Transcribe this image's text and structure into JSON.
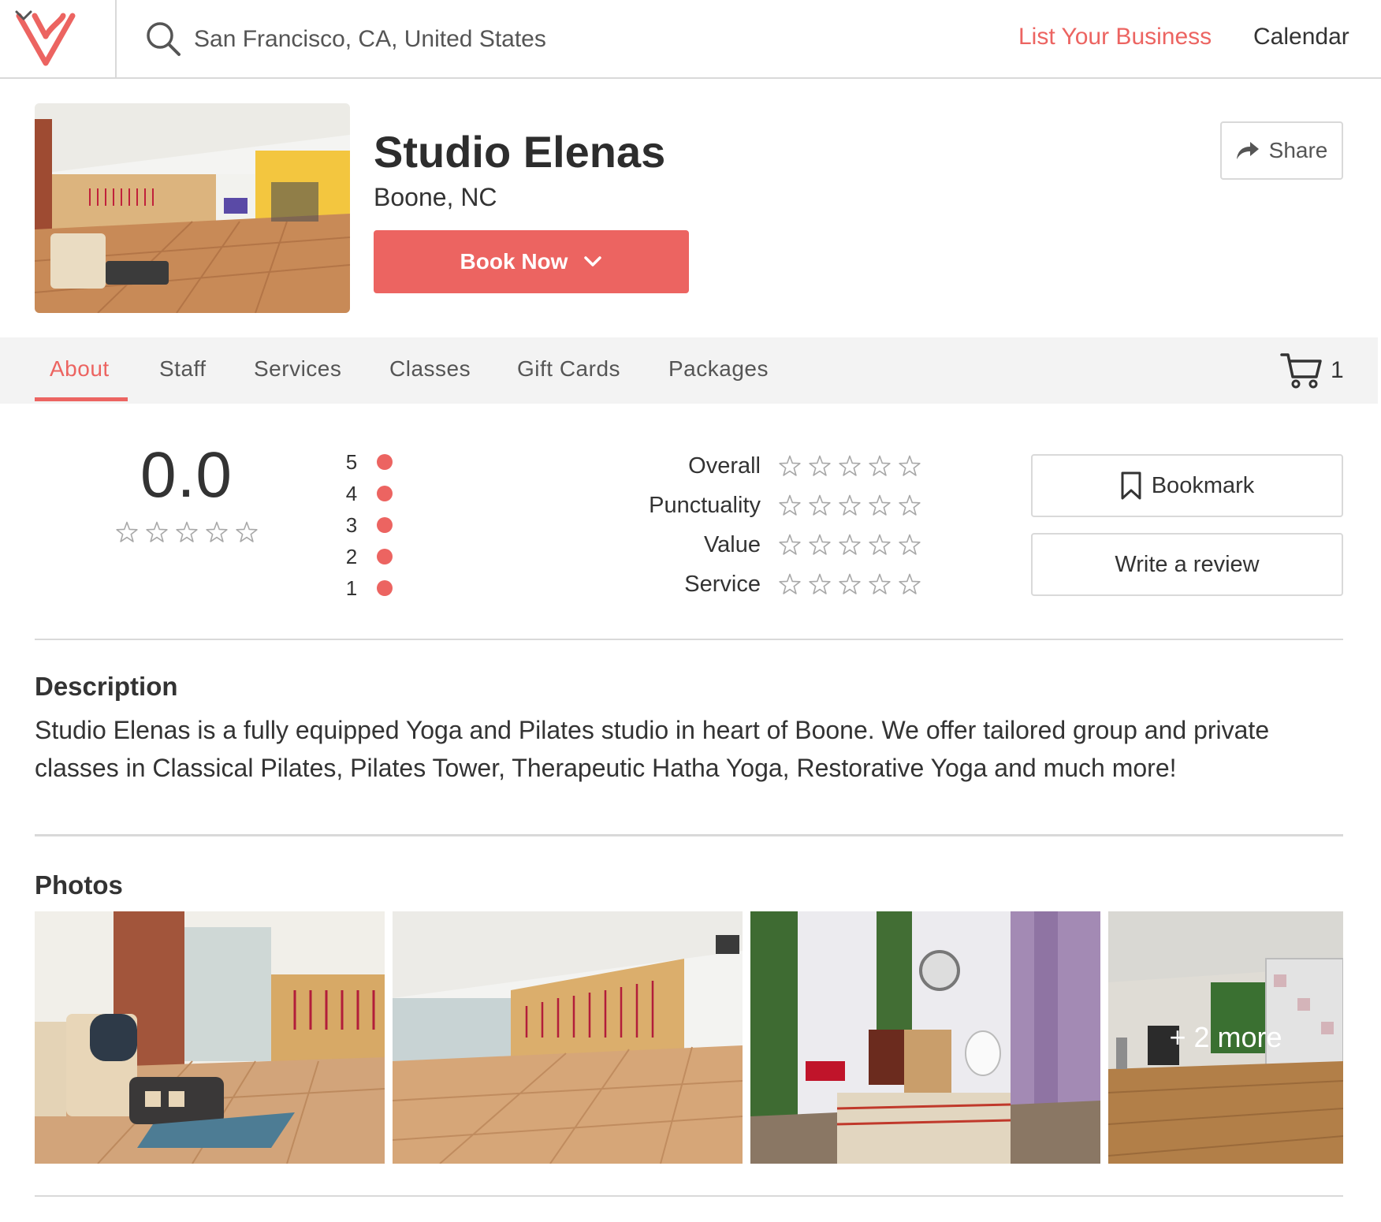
{
  "header": {
    "search_placeholder": "San Francisco, CA, United States",
    "list_business": "List Your Business",
    "calendar": "Calendar"
  },
  "business": {
    "name": "Studio Elenas",
    "location": "Boone, NC",
    "book_label": "Book Now",
    "share_label": "Share"
  },
  "tabs": [
    {
      "label": "About",
      "active": true
    },
    {
      "label": "Staff"
    },
    {
      "label": "Services"
    },
    {
      "label": "Classes"
    },
    {
      "label": "Gift Cards"
    },
    {
      "label": "Packages"
    }
  ],
  "cart": {
    "count": "1"
  },
  "rating": {
    "score": "0.0",
    "breakdown": [
      "5",
      "4",
      "3",
      "2",
      "1"
    ],
    "categories": [
      "Overall",
      "Punctuality",
      "Value",
      "Service"
    ],
    "bookmark_label": "Bookmark",
    "review_label": "Write a review"
  },
  "description": {
    "title": "Description",
    "text": "Studio Elenas is a fully equipped Yoga and Pilates studio in heart of Boone. We offer tailored group and private classes in Classical Pilates, Pilates Tower, Therapeutic Hatha Yoga, Restorative Yoga and much more!"
  },
  "photos": {
    "title": "Photos",
    "more_label": "+ 2 more"
  },
  "colors": {
    "accent": "#ec6461",
    "border": "#d9d9d9",
    "tabbar": "#f3f3f3"
  }
}
